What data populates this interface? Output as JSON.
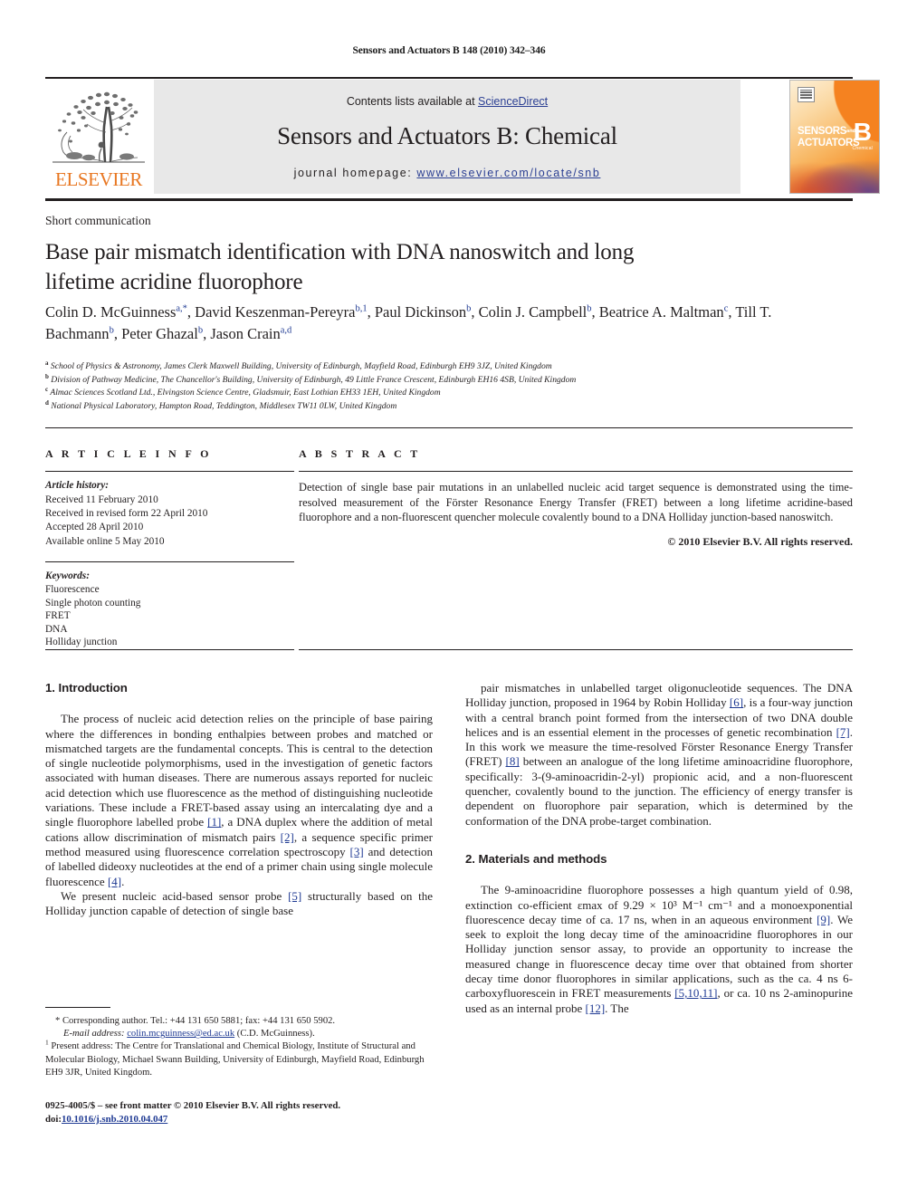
{
  "running_head": "Sensors and Actuators B 148 (2010) 342–346",
  "masthead": {
    "contents_prefix": "Contents lists available at ",
    "sciencedirect": "ScienceDirect",
    "journal_title": "Sensors and Actuators B: Chemical",
    "homepage_label": "journal homepage: ",
    "homepage_url": "www.elsevier.com/locate/snb",
    "publisher": "ELSEVIER",
    "cover": {
      "line1": "SENSORS",
      "and": "and",
      "line2": "ACTUATORS",
      "letter": "B",
      "sub": "Chemical"
    },
    "colors": {
      "band": "#e8e8e8",
      "link": "#2b3f93",
      "elsevier_orange": "#E87722",
      "rule": "#231f20"
    }
  },
  "article": {
    "doctype": "Short communication",
    "title": "Base pair mismatch identification with DNA nanoswitch and long lifetime acridine fluorophore",
    "authors": [
      {
        "name": "Colin D. McGuinness",
        "sup": "a,*",
        "sep": ", "
      },
      {
        "name": "David Keszenman-Pereyra",
        "sup": "b,1",
        "sep": ", "
      },
      {
        "name": "Paul Dickinson",
        "sup": "b",
        "sep": ", "
      },
      {
        "name": "Colin J. Campbell",
        "sup": "b",
        "sep": ", "
      },
      {
        "name": "Beatrice A. Maltman",
        "sup": "c",
        "sep": ", "
      },
      {
        "name": "Till T. Bachmann",
        "sup": "b",
        "sep": ", "
      },
      {
        "name": "Peter Ghazal",
        "sup": "b",
        "sep": ", "
      },
      {
        "name": "Jason Crain",
        "sup": "a,d",
        "sep": ""
      }
    ],
    "affiliations": [
      {
        "mark": "a",
        "text": "School of Physics & Astronomy, James Clerk Maxwell Building, University of Edinburgh, Mayfield Road, Edinburgh EH9 3JZ, United Kingdom"
      },
      {
        "mark": "b",
        "text": "Division of Pathway Medicine, The Chancellor's Building, University of Edinburgh, 49 Little France Crescent, Edinburgh EH16 4SB, United Kingdom"
      },
      {
        "mark": "c",
        "text": "Almac Sciences Scotland Ltd., Elvingston Science Centre, Gladsmuir, East Lothian EH33 1EH, United Kingdom"
      },
      {
        "mark": "d",
        "text": "National Physical Laboratory, Hampton Road, Teddington, Middlesex TW11 0LW, United Kingdom"
      }
    ]
  },
  "info": {
    "heading": "A R T I C L E   I N F O",
    "history_label": "Article history:",
    "history": [
      "Received 11 February 2010",
      "Received in revised form 22 April 2010",
      "Accepted 28 April 2010",
      "Available online 5 May 2010"
    ],
    "keywords_label": "Keywords:",
    "keywords": [
      "Fluorescence",
      "Single photon counting",
      "FRET",
      "DNA",
      "Holliday junction"
    ]
  },
  "abstract": {
    "heading": "A B S T R A C T",
    "text": "Detection of single base pair mutations in an unlabelled nucleic acid target sequence is demonstrated using the time-resolved measurement of the Förster Resonance Energy Transfer (FRET) between a long lifetime acridine-based fluorophore and a non-fluorescent quencher molecule covalently bound to a DNA Holliday junction-based nanoswitch.",
    "copyright": "© 2010 Elsevier B.V. All rights reserved."
  },
  "body": {
    "section1_heading": "1.  Introduction",
    "section2_heading": "2.  Materials and methods",
    "left_para1": "The process of nucleic acid detection relies on the principle of base pairing where the differences in bonding enthalpies between probes and matched or mismatched targets are the fundamental concepts. This is central to the detection of single nucleotide polymorphisms, used in the investigation of genetic factors associated with human diseases. There are numerous assays reported for nucleic acid detection which use fluorescence as the method of distinguishing nucleotide variations. These include a FRET-based assay using an intercalating dye and a single fluorophore labelled probe [1], a DNA duplex where the addition of metal cations allow discrimination of mismatch pairs [2], a sequence specific primer method measured using fluorescence correlation spectroscopy [3] and detection of labelled dideoxy nucleotides at the end of a primer chain using single molecule fluorescence [4].",
    "left_para2": "We present nucleic acid-based sensor probe [5] structurally based on the Holliday junction capable of detection of single base",
    "right_para1": "pair mismatches in unlabelled target oligonucleotide sequences. The DNA Holliday junction, proposed in 1964 by Robin Holliday [6], is a four-way junction with a central branch point formed from the intersection of two DNA double helices and is an essential element in the processes of genetic recombination [7]. In this work we measure the time-resolved Förster Resonance Energy Transfer (FRET) [8] between an analogue of the long lifetime aminoacridine fluorophore, specifically: 3-(9-aminoacridin-2-yl) propionic acid, and a non-fluorescent quencher, covalently bound to the junction. The efficiency of energy transfer is dependent on fluorophore pair separation, which is determined by the conformation of the DNA probe-target combination.",
    "right_para2": "The 9-aminoacridine fluorophore possesses a high quantum yield of 0.98, extinction co-efficient εmax of 9.29 × 10³ M⁻¹ cm⁻¹ and a monoexponential fluorescence decay time of ca. 17 ns, when in an aqueous environment [9]. We seek to exploit the long decay time of the aminoacridine fluorophores in our Holliday junction sensor assay, to provide an opportunity to increase the measured change in fluorescence decay time over that obtained from shorter decay time donor fluorophores in similar applications, such as the ca. 4 ns 6-carboxyfluorescein in FRET measurements [5,10,11], or ca. 10 ns 2-aminopurine used as an internal probe [12]. The"
  },
  "footnotes": {
    "corresponding": "* Corresponding author. Tel.: +44 131 650 5881; fax: +44 131 650 5902.",
    "email_label": "E-mail address:",
    "email": "colin.mcguinness@ed.ac.uk",
    "email_suffix": "(C.D. McGuinness).",
    "present_address": "Present address: The Centre for Translational and Chemical Biology, Institute of Structural and Molecular Biology, Michael Swann Building, University of Edinburgh, Mayfield Road, Edinburgh EH9 3JR, United Kingdom.",
    "present_mark": "1"
  },
  "colophon": {
    "line1": "0925-4005/$ – see front matter © 2010 Elsevier B.V. All rights reserved.",
    "doi_label": "doi:",
    "doi": "10.1016/j.snb.2010.04.047"
  }
}
